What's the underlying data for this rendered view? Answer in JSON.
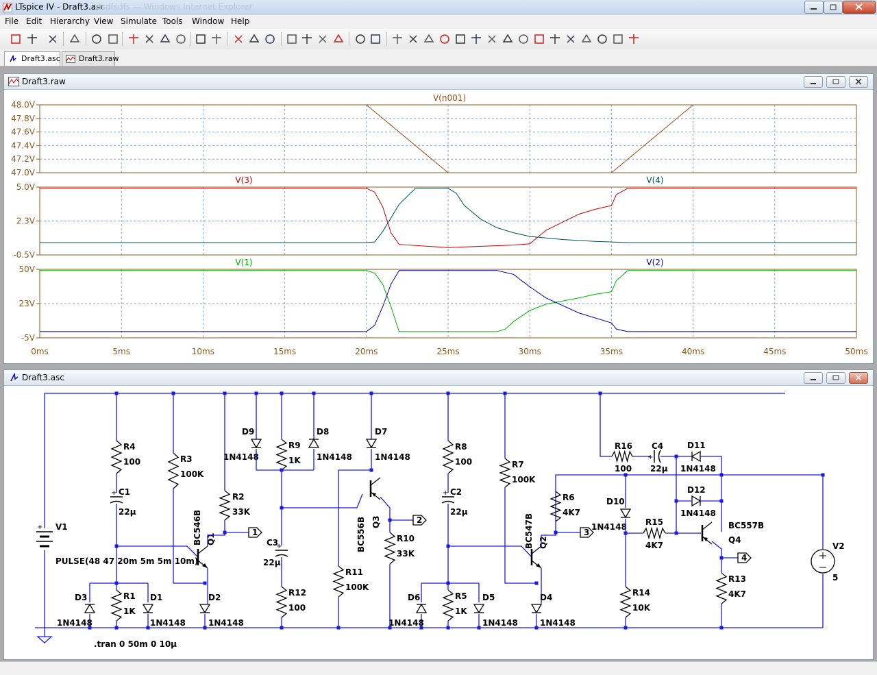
{
  "app": {
    "title": "LTspice IV - Draft3.asc",
    "title_blurred": "dsdfsdfs — Windows Internet Explorer"
  },
  "menu": [
    "File",
    "Edit",
    "Hierarchy",
    "View",
    "Simulate",
    "Tools",
    "Window",
    "Help"
  ],
  "toolbar_icons": [
    "new-schematic-icon",
    "open-icon",
    "save-icon",
    "control-panel-icon",
    "run-icon",
    "halt-icon",
    "zoom-in-icon",
    "zoom-pan-icon",
    "zoom-out-icon",
    "zoom-cancel-icon",
    "autorange-icon",
    "grid-icon",
    "tile-horizontal-icon",
    "cascade-icon",
    "close-all-icon",
    "cut-icon",
    "copy-icon",
    "paste-icon",
    "find-icon",
    "print-setup-icon",
    "print-icon",
    "wire-icon",
    "ground-icon",
    "label-icon",
    "resistor-icon",
    "capacitor-icon",
    "inductor-icon",
    "diode-icon",
    "component-icon",
    "move-icon",
    "drag-icon",
    "undo-icon",
    "redo-icon",
    "rotate-icon",
    "mirror-icon",
    "text-icon",
    "spice-directive-icon"
  ],
  "tabs": [
    {
      "label": "Draft3.asc",
      "icon": "schematic-icon",
      "active": true
    },
    {
      "label": "Draft3.raw",
      "icon": "waveform-icon",
      "active": false
    }
  ],
  "waveform_window": {
    "title": "Draft3.raw"
  },
  "schematic_window": {
    "title": "Draft3.asc"
  },
  "colors": {
    "n001": "#9a4a16",
    "v3": "#c00000",
    "v4": "#005050",
    "v1": "#00b000",
    "v2": "#0000a0",
    "axis": "#8a5a22",
    "grid": "#8ca2c8",
    "wire": "#1a1adb",
    "node": "#1a1adb"
  },
  "chart_data": [
    {
      "type": "line",
      "title": "",
      "ylim": [
        47.0,
        48.0
      ],
      "yticks": [
        "48.0V",
        "47.8V",
        "47.6V",
        "47.4V",
        "47.2V",
        "47.0V"
      ],
      "series": [
        {
          "name": "V(n001)",
          "color": "#9a4a16",
          "x": [
            20,
            25,
            25.01,
            35,
            35.01,
            40
          ],
          "y": [
            48.0,
            47.0,
            null,
            null,
            47.0,
            48.0
          ]
        }
      ]
    },
    {
      "type": "line",
      "ylim": [
        -0.5,
        5.0
      ],
      "yticks": [
        "5.0V",
        "2.3V",
        "-0.5V"
      ],
      "series": [
        {
          "name": "V(3)",
          "color": "#c00000",
          "x": [
            0,
            20,
            20.5,
            21,
            21.5,
            22,
            25,
            29,
            30,
            31,
            33,
            34,
            35,
            35.3,
            36,
            50
          ],
          "y": [
            4.9,
            4.9,
            4.6,
            3.4,
            1.3,
            0.35,
            0.1,
            0.3,
            0.4,
            1.5,
            2.8,
            3.2,
            3.5,
            4.4,
            4.9,
            4.9
          ]
        },
        {
          "name": "V(4)",
          "color": "#005050",
          "x": [
            0,
            20,
            20.5,
            21,
            22,
            23,
            24,
            25,
            25.5,
            26,
            27,
            28,
            29,
            30,
            32,
            34,
            35,
            36,
            50
          ],
          "y": [
            0.5,
            0.5,
            0.55,
            1.4,
            3.6,
            4.9,
            4.9,
            4.9,
            4.5,
            3.5,
            2.4,
            1.7,
            1.3,
            1.0,
            0.75,
            0.6,
            0.55,
            0.5,
            0.5
          ]
        }
      ]
    },
    {
      "type": "line",
      "ylim": [
        -5,
        50
      ],
      "yticks": [
        "50V",
        "23V",
        "-5V"
      ],
      "series": [
        {
          "name": "V(1)",
          "color": "#00b000",
          "x": [
            0,
            20,
            20.5,
            21,
            21.5,
            22,
            28,
            28.5,
            29,
            30,
            31,
            33,
            34,
            35,
            35.3,
            36,
            50
          ],
          "y": [
            49,
            49,
            47,
            38,
            20,
            0,
            0,
            2,
            8,
            17,
            22,
            27,
            30,
            32,
            41,
            49,
            49
          ]
        },
        {
          "name": "V(2)",
          "color": "#0000a0",
          "x": [
            0,
            20,
            20.5,
            21,
            21.5,
            22,
            28,
            29,
            30,
            31,
            33,
            35,
            35.3,
            36,
            50
          ],
          "y": [
            0,
            0,
            5,
            20,
            38,
            49,
            49,
            46,
            36,
            27,
            15,
            7,
            2,
            0,
            0
          ]
        }
      ]
    }
  ],
  "x_axis": {
    "xlim": [
      0,
      50
    ],
    "ticks": [
      "0ms",
      "5ms",
      "10ms",
      "15ms",
      "20ms",
      "25ms",
      "30ms",
      "35ms",
      "40ms",
      "45ms",
      "50ms"
    ]
  },
  "schematic": {
    "components": {
      "V1": {
        "name": "V1",
        "value": "PULSE(48 47 20m 5m 5m 10m)"
      },
      "V2": {
        "name": "V2",
        "value": "5"
      },
      "R1": {
        "name": "R1",
        "value": "1K"
      },
      "R2": {
        "name": "R2",
        "value": "33K"
      },
      "R3": {
        "name": "R3",
        "value": "100K"
      },
      "R4": {
        "name": "R4",
        "value": "100"
      },
      "R5": {
        "name": "R5",
        "value": "1K"
      },
      "R6": {
        "name": "R6",
        "value": "4K7"
      },
      "R7": {
        "name": "R7",
        "value": "100K"
      },
      "R8": {
        "name": "R8",
        "value": "100"
      },
      "R9": {
        "name": "R9",
        "value": "1K"
      },
      "R10": {
        "name": "R10",
        "value": "33K"
      },
      "R11": {
        "name": "R11",
        "value": "100K"
      },
      "R12": {
        "name": "R12",
        "value": "100"
      },
      "R13": {
        "name": "R13",
        "value": "4K7"
      },
      "R14": {
        "name": "R14",
        "value": "10K"
      },
      "R15": {
        "name": "R15",
        "value": "4K7"
      },
      "R16": {
        "name": "R16",
        "value": "100"
      },
      "C1": {
        "name": "C1",
        "value": "22µ"
      },
      "C2": {
        "name": "C2",
        "value": "22µ"
      },
      "C3": {
        "name": "C3",
        "value": "22µ"
      },
      "C4": {
        "name": "C4",
        "value": "22µ"
      },
      "D1": {
        "name": "D1",
        "value": "1N4148"
      },
      "D2": {
        "name": "D2",
        "value": "1N4148"
      },
      "D3": {
        "name": "D3",
        "value": "1N4148"
      },
      "D4": {
        "name": "D4",
        "value": "1N4148"
      },
      "D5": {
        "name": "D5",
        "value": "1N4148"
      },
      "D6": {
        "name": "D6",
        "value": "1N4148"
      },
      "D7": {
        "name": "D7",
        "value": "1N4148"
      },
      "D8": {
        "name": "D8",
        "value": "1N4148"
      },
      "D9": {
        "name": "D9",
        "value": "1N4148"
      },
      "D10": {
        "name": "D10",
        "value": "1N4148"
      },
      "D11": {
        "name": "D11",
        "value": "1N4148"
      },
      "D12": {
        "name": "D12",
        "value": "1N4148"
      },
      "Q1": {
        "name": "Q1",
        "value": "BC546B"
      },
      "Q2": {
        "name": "Q2",
        "value": "BC547B"
      },
      "Q3": {
        "name": "Q3",
        "value": "BC556B"
      },
      "Q4": {
        "name": "Q4",
        "value": "BC557B"
      }
    },
    "net_labels": {
      "n1": "1",
      "n2": "2",
      "n3": "3",
      "n4": "4"
    },
    "directive": ".tran 0 50m 0 10µ"
  }
}
